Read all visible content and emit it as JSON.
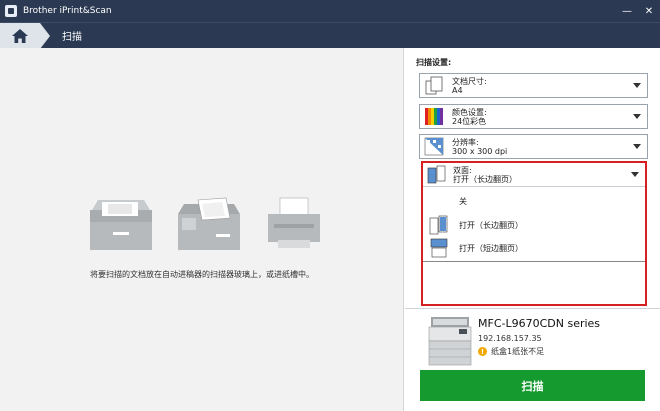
{
  "window": {
    "title": "Brother iPrint&Scan"
  },
  "nav": {
    "title": "扫描"
  },
  "main": {
    "instruction": "将要扫描的文档放在自动进稿器的扫描器玻璃上，或进纸槽中。"
  },
  "settings": {
    "title": "扫描设置:",
    "doc_size": {
      "label": "文档尺寸:",
      "value": "A4"
    },
    "color": {
      "label": "颜色设置:",
      "value": "24位彩色"
    },
    "resolution": {
      "label": "分辨率:",
      "value": "300 x 300 dpi"
    },
    "duplex": {
      "label": "双面:",
      "value": "打开（长边翻页）",
      "options": [
        "关",
        "打开（长边翻页）",
        "打开（短边翻页）"
      ]
    }
  },
  "printer": {
    "name": "MFC-L9670CDN series",
    "ip": "192.168.157.35",
    "warning": "纸盒1纸张不足"
  },
  "scan_button": {
    "label": "扫描"
  },
  "colors": {
    "titlebar": "#2b3a52",
    "highlight": "#d42020",
    "scan_button": "#159a30"
  }
}
